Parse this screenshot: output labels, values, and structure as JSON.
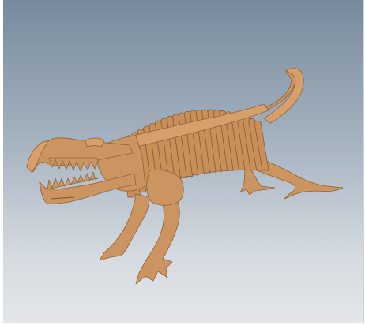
{
  "viewport": {
    "model": "cardboard-crocodile-dinosaur",
    "colors": {
      "background_top": "#778a9c",
      "background_bottom": "#e4e6e9",
      "material": "#cc9460",
      "material_edge": "#8f6237"
    }
  }
}
